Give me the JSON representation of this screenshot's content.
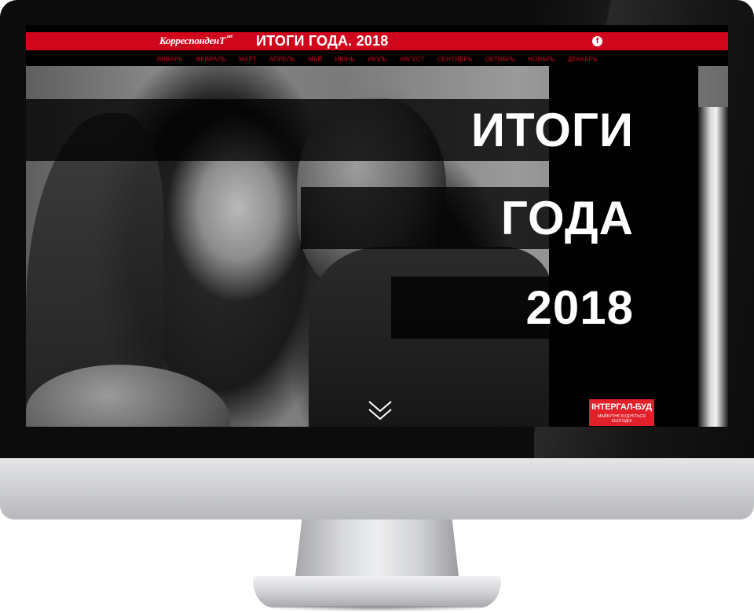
{
  "header": {
    "logo_text": "КорреспонденТ",
    "logo_suffix": ".net",
    "title": "ИТОГИ ГОДА. 2018",
    "social_icon": "facebook-icon",
    "social_glyph": "f"
  },
  "months": [
    "ЯНВАРЬ",
    "ФЕВРАЛЬ",
    "МАРТ",
    "АПРЕЛЬ",
    "МАЙ",
    "ИЮНЬ",
    "ИЮЛЬ",
    "АВГУСТ",
    "СЕНТЯБРЬ",
    "ОКТЯБРЬ",
    "НОЯБРЬ",
    "ДЕКАБРЬ"
  ],
  "hero": {
    "line1": "ИТОГИ",
    "line2": "ГОДА",
    "line3": "2018",
    "scroll_icon": "chevron-double-down-icon"
  },
  "sponsor": {
    "name": "ІНТЕРГАЛ-БУД",
    "tagline": "МАЙБУТНЄ БУДУЄТЬСЯ СЬОГОДНІ"
  },
  "colors": {
    "brand_red": "#d0061d",
    "sponsor_red": "#e2202a"
  }
}
